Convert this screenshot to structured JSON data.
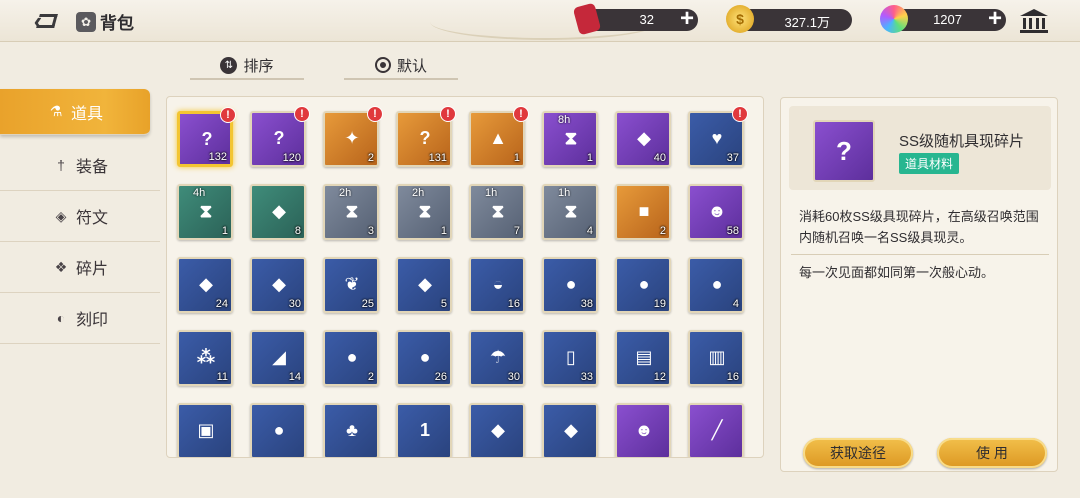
{
  "header": {
    "title": "背包",
    "resources": [
      {
        "name": "ticket",
        "value": "32",
        "icon": "ticket-icon"
      },
      {
        "name": "coin",
        "value": "327.1万",
        "icon": "coin-icon"
      },
      {
        "name": "gem",
        "value": "1207",
        "icon": "gem-icon"
      }
    ]
  },
  "sort": {
    "order_label": "排序",
    "default_label": "默认"
  },
  "tabs": [
    {
      "label": "道具",
      "icon": "flask-icon",
      "active": true
    },
    {
      "label": "装备",
      "icon": "sword-icon",
      "active": false
    },
    {
      "label": "符文",
      "icon": "rune-icon",
      "active": false
    },
    {
      "label": "碎片",
      "icon": "shard-icon",
      "active": false
    },
    {
      "label": "刻印",
      "icon": "seal-icon",
      "active": false
    }
  ],
  "items": [
    {
      "count": "132",
      "timer": "",
      "alert": true,
      "color": "purple",
      "glyph": "?",
      "selected": true
    },
    {
      "count": "120",
      "timer": "",
      "alert": true,
      "color": "purple",
      "glyph": "?"
    },
    {
      "count": "2",
      "timer": "",
      "alert": true,
      "color": "orange",
      "glyph": "✦"
    },
    {
      "count": "131",
      "timer": "",
      "alert": true,
      "color": "orange",
      "glyph": "?"
    },
    {
      "count": "1",
      "timer": "",
      "alert": true,
      "color": "orange",
      "glyph": "▲"
    },
    {
      "count": "1",
      "timer": "8h",
      "alert": false,
      "color": "purple",
      "glyph": "⧗"
    },
    {
      "count": "40",
      "timer": "",
      "alert": false,
      "color": "purple",
      "glyph": "◆"
    },
    {
      "count": "37",
      "timer": "",
      "alert": true,
      "color": "blue",
      "glyph": "♥"
    },
    {
      "count": "1",
      "timer": "4h",
      "alert": false,
      "color": "green",
      "glyph": "⧗"
    },
    {
      "count": "8",
      "timer": "",
      "alert": false,
      "color": "green",
      "glyph": "◆"
    },
    {
      "count": "3",
      "timer": "2h",
      "alert": false,
      "color": "gray",
      "glyph": "⧗"
    },
    {
      "count": "1",
      "timer": "2h",
      "alert": false,
      "color": "gray",
      "glyph": "⧗"
    },
    {
      "count": "7",
      "timer": "1h",
      "alert": false,
      "color": "gray",
      "glyph": "⧗"
    },
    {
      "count": "4",
      "timer": "1h",
      "alert": false,
      "color": "gray",
      "glyph": "⧗"
    },
    {
      "count": "2",
      "timer": "",
      "alert": false,
      "color": "orange",
      "glyph": "■"
    },
    {
      "count": "58",
      "timer": "",
      "alert": false,
      "color": "purple",
      "glyph": "☻"
    },
    {
      "count": "24",
      "timer": "",
      "alert": false,
      "color": "blue",
      "glyph": "◆"
    },
    {
      "count": "30",
      "timer": "",
      "alert": false,
      "color": "blue",
      "glyph": "◆"
    },
    {
      "count": "25",
      "timer": "",
      "alert": false,
      "color": "blue",
      "glyph": "❦"
    },
    {
      "count": "5",
      "timer": "",
      "alert": false,
      "color": "blue",
      "glyph": "◆"
    },
    {
      "count": "16",
      "timer": "",
      "alert": false,
      "color": "blue",
      "glyph": "◒"
    },
    {
      "count": "38",
      "timer": "",
      "alert": false,
      "color": "blue",
      "glyph": "●"
    },
    {
      "count": "19",
      "timer": "",
      "alert": false,
      "color": "blue",
      "glyph": "●"
    },
    {
      "count": "4",
      "timer": "",
      "alert": false,
      "color": "blue",
      "glyph": "●"
    },
    {
      "count": "11",
      "timer": "",
      "alert": false,
      "color": "blue",
      "glyph": "⁂"
    },
    {
      "count": "14",
      "timer": "",
      "alert": false,
      "color": "blue",
      "glyph": "◢"
    },
    {
      "count": "2",
      "timer": "",
      "alert": false,
      "color": "blue",
      "glyph": "●"
    },
    {
      "count": "26",
      "timer": "",
      "alert": false,
      "color": "blue",
      "glyph": "●"
    },
    {
      "count": "30",
      "timer": "",
      "alert": false,
      "color": "blue",
      "glyph": "☂"
    },
    {
      "count": "33",
      "timer": "",
      "alert": false,
      "color": "blue",
      "glyph": "▯"
    },
    {
      "count": "12",
      "timer": "",
      "alert": false,
      "color": "blue",
      "glyph": "▤"
    },
    {
      "count": "16",
      "timer": "",
      "alert": false,
      "color": "blue",
      "glyph": "▥"
    },
    {
      "count": "",
      "timer": "",
      "alert": false,
      "color": "blue",
      "glyph": "▣"
    },
    {
      "count": "",
      "timer": "",
      "alert": false,
      "color": "blue",
      "glyph": "●"
    },
    {
      "count": "",
      "timer": "",
      "alert": false,
      "color": "blue",
      "glyph": "♣"
    },
    {
      "count": "",
      "timer": "",
      "alert": false,
      "color": "blue",
      "glyph": "1"
    },
    {
      "count": "",
      "timer": "",
      "alert": false,
      "color": "blue",
      "glyph": "◆"
    },
    {
      "count": "",
      "timer": "",
      "alert": false,
      "color": "blue",
      "glyph": "◆"
    },
    {
      "count": "",
      "timer": "",
      "alert": false,
      "color": "purple",
      "glyph": "☻"
    },
    {
      "count": "",
      "timer": "",
      "alert": false,
      "color": "purple",
      "glyph": "╱"
    }
  ],
  "detail": {
    "name": "SS级随机具现碎片",
    "tag": "道具材料",
    "description": "消耗60枚SS级具现碎片，在高级召唤范围内随机召唤一名SS级具现灵。",
    "flavor": "每一次见面都如同第一次般心动。",
    "source_button": "获取途径",
    "use_button": "使 用"
  }
}
